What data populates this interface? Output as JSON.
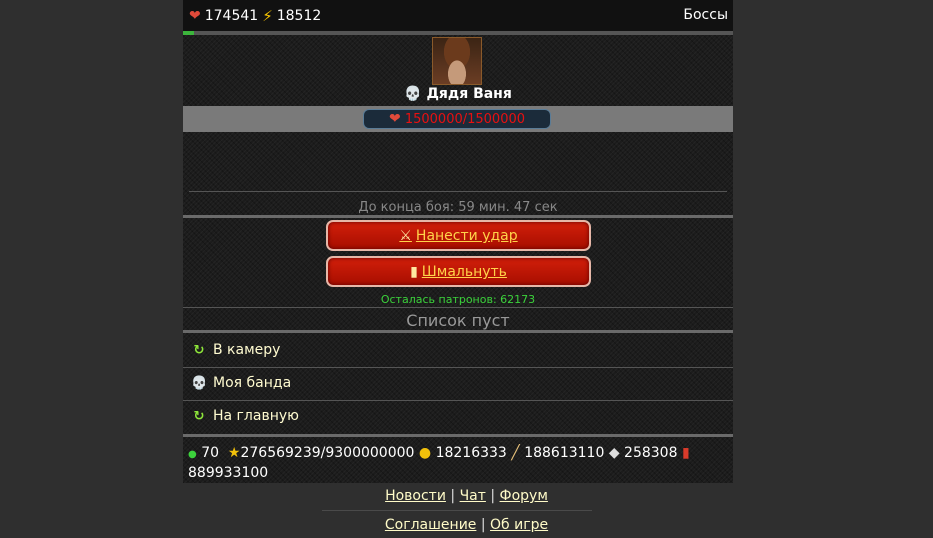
{
  "topbar": {
    "health": "174541",
    "energy": "18512",
    "bosses_link": "Боссы",
    "progress_fraction": 0.02
  },
  "boss": {
    "name": "Дядя Ваня",
    "hp": "1500000/1500000"
  },
  "timer": "До конца боя: 59 мин. 47 сек",
  "actions": {
    "hit": "Нанести удар",
    "shoot": "Шмальнуть"
  },
  "ammo": "Осталась патронов: 62173",
  "list_empty": "Список пуст",
  "nav": [
    {
      "label": "В камеру",
      "icon": "green-arrow-icon"
    },
    {
      "label": "Моя банда",
      "icon": "skull-icon"
    },
    {
      "label": "На главную",
      "icon": "green-arrow-icon"
    }
  ],
  "stats": {
    "level": "70",
    "experience": "276569239/9300000000",
    "coins": "18216333",
    "pencils": "188613110",
    "dice": "258308",
    "cards": "889933100"
  },
  "footer": {
    "news": "Новости",
    "chat": "Чат",
    "forum": "Форум",
    "agreement": "Соглашение",
    "about": "Об игре",
    "sep": "|"
  },
  "colors": {
    "hp_text": "#e81010",
    "button_red": "#c51806",
    "ammo_green": "#3bd23b",
    "link_yellow": "#fffbc8"
  }
}
